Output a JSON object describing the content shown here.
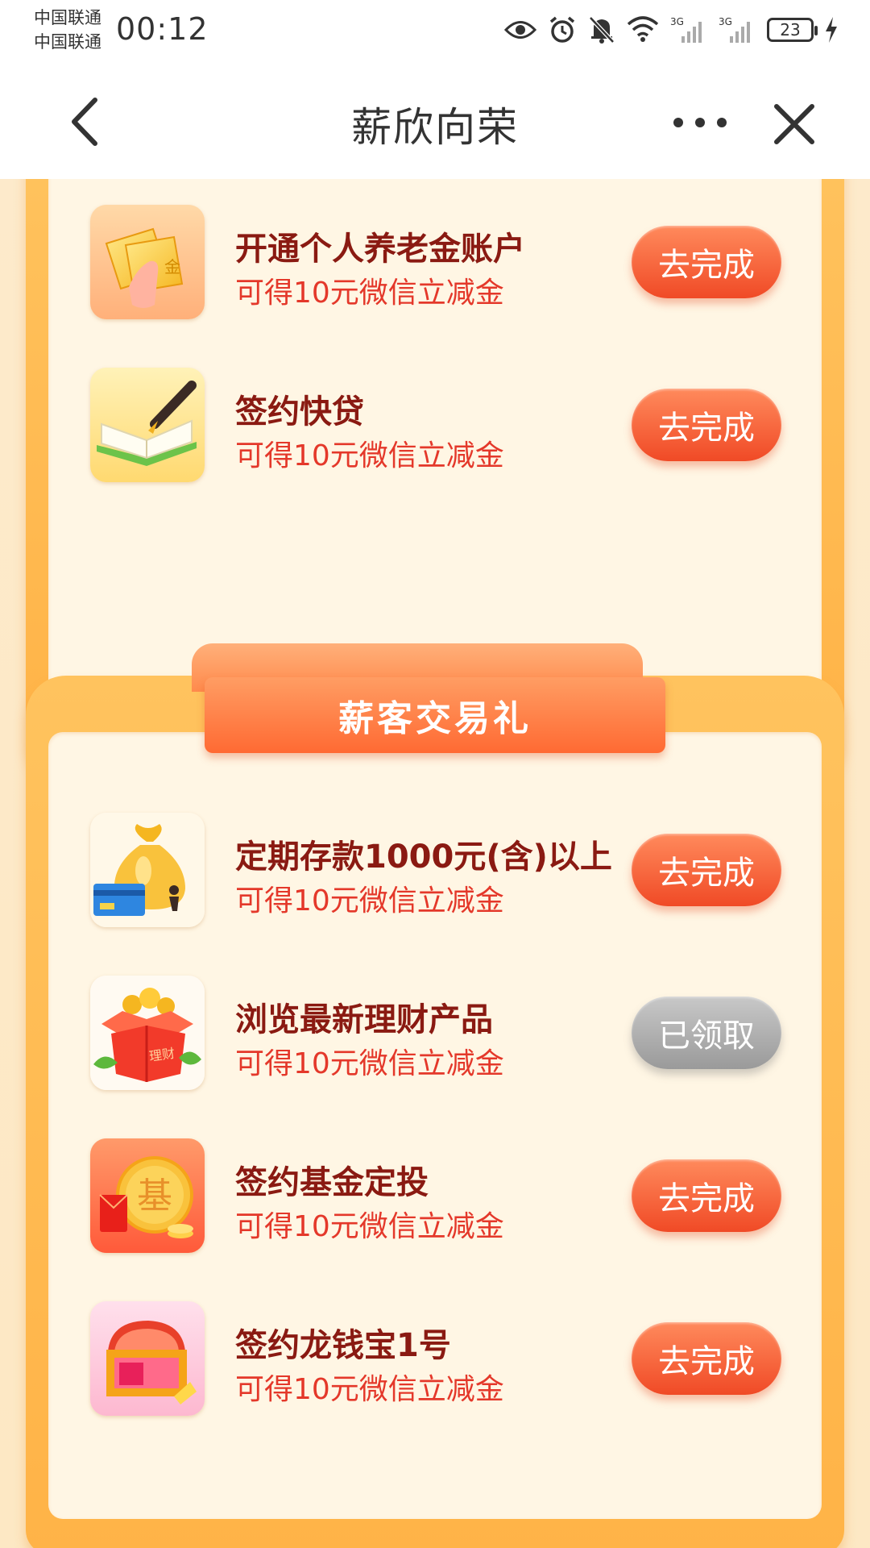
{
  "status_bar": {
    "carrier_1": "中国联通",
    "carrier_2": "中国联通",
    "time": "00:12",
    "network_1": "3G",
    "network_2": "3G",
    "battery": "23"
  },
  "nav": {
    "title": "薪欣向荣",
    "icons": [
      "back-arrow-icon",
      "more-dots-icon",
      "close-icon"
    ]
  },
  "section_top": {
    "tasks": [
      {
        "title": "开通个人养老金账户",
        "reward": "可得10元微信立减金",
        "button": "去完成",
        "icon": "pension-gold-icon",
        "icon_label": "金"
      },
      {
        "title": "签约快贷",
        "reward": "可得10元微信立减金",
        "button": "去完成",
        "icon": "pen-notebook-icon"
      }
    ]
  },
  "section_trade": {
    "title": "薪客交易礼",
    "tasks": [
      {
        "title": "定期存款1000元(含)以上",
        "reward": "可得10元微信立减金",
        "button": "去完成",
        "icon": "money-bag-icon"
      },
      {
        "title": "浏览最新理财产品",
        "reward": "可得10元微信立减金",
        "button": "已领取",
        "icon": "gift-box-icon",
        "icon_label": "理财",
        "claimed": true
      },
      {
        "title": "签约基金定投",
        "reward": "可得10元微信立减金",
        "button": "去完成",
        "icon": "fund-coin-icon",
        "icon_label": "基"
      },
      {
        "title": "签约龙钱宝1号",
        "reward": "可得10元微信立减金",
        "button": "去完成",
        "icon": "treasure-chest-icon"
      }
    ]
  },
  "colors": {
    "accent": "#f04a26",
    "title_text": "#8a1a12",
    "reward_text": "#e4382a",
    "panel": "#ffb347",
    "panel_inner": "#fff6e4",
    "claimed": "#9a9a9a"
  }
}
